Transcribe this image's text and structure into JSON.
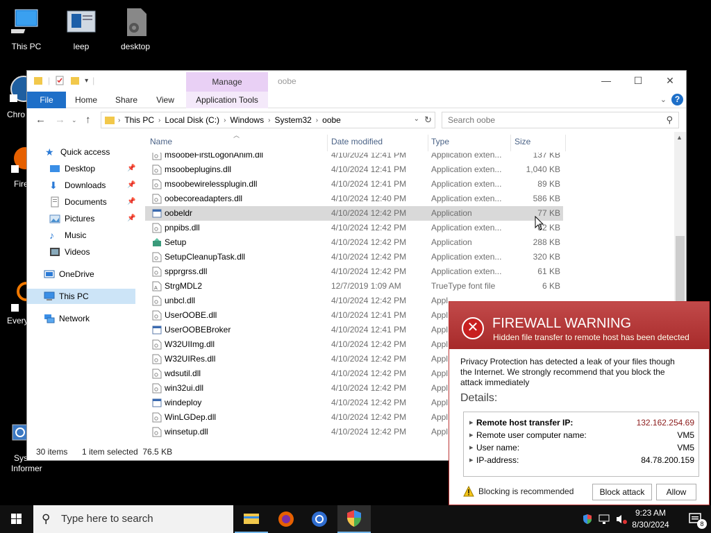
{
  "desktop": {
    "icons": [
      {
        "label": "This PC"
      },
      {
        "label": "leep"
      },
      {
        "label": "desktop"
      }
    ],
    "partial_labels": [
      "Chro",
      "Fire",
      "Every",
      "Sys",
      "Informer"
    ]
  },
  "explorer": {
    "title": "oobe",
    "manage_label": "Manage",
    "tabs": [
      "File",
      "Home",
      "Share",
      "View",
      "Application Tools"
    ],
    "breadcrumbs": [
      "This PC",
      "Local Disk (C:)",
      "Windows",
      "System32",
      "oobe"
    ],
    "search_placeholder": "Search oobe",
    "nav": {
      "quick_access": "Quick access",
      "items": [
        "Desktop",
        "Downloads",
        "Documents",
        "Pictures",
        "Music",
        "Videos"
      ],
      "onedrive": "OneDrive",
      "this_pc": "This PC",
      "network": "Network"
    },
    "columns": {
      "name": "Name",
      "date": "Date modified",
      "type": "Type",
      "size": "Size"
    },
    "files": [
      {
        "name": "msoobeFirstLogonAnim.dll",
        "date": "4/10/2024 12:41 PM",
        "type": "Application exten...",
        "size": "137 KB",
        "icon": "dll"
      },
      {
        "name": "msoobeplugins.dll",
        "date": "4/10/2024 12:41 PM",
        "type": "Application exten...",
        "size": "1,040 KB",
        "icon": "dll"
      },
      {
        "name": "msoobewirelessplugin.dll",
        "date": "4/10/2024 12:41 PM",
        "type": "Application exten...",
        "size": "89 KB",
        "icon": "dll"
      },
      {
        "name": "oobecoreadapters.dll",
        "date": "4/10/2024 12:40 PM",
        "type": "Application exten...",
        "size": "586 KB",
        "icon": "dll"
      },
      {
        "name": "oobeldr",
        "date": "4/10/2024 12:42 PM",
        "type": "Application",
        "size": "77 KB",
        "icon": "exe",
        "selected": true
      },
      {
        "name": "pnpibs.dll",
        "date": "4/10/2024 12:42 PM",
        "type": "Application exten...",
        "size": "82 KB",
        "icon": "dll"
      },
      {
        "name": "Setup",
        "date": "4/10/2024 12:42 PM",
        "type": "Application",
        "size": "288 KB",
        "icon": "setup"
      },
      {
        "name": "SetupCleanupTask.dll",
        "date": "4/10/2024 12:42 PM",
        "type": "Application exten...",
        "size": "320 KB",
        "icon": "dll"
      },
      {
        "name": "spprgrss.dll",
        "date": "4/10/2024 12:42 PM",
        "type": "Application exten...",
        "size": "61 KB",
        "icon": "dll"
      },
      {
        "name": "StrgMDL2",
        "date": "12/7/2019 1:09 AM",
        "type": "TrueType font file",
        "size": "6 KB",
        "icon": "font"
      },
      {
        "name": "unbcl.dll",
        "date": "4/10/2024 12:42 PM",
        "type": "Appl",
        "size": "",
        "icon": "dll"
      },
      {
        "name": "UserOOBE.dll",
        "date": "4/10/2024 12:41 PM",
        "type": "Appl",
        "size": "",
        "icon": "dll"
      },
      {
        "name": "UserOOBEBroker",
        "date": "4/10/2024 12:41 PM",
        "type": "Appl",
        "size": "",
        "icon": "exe"
      },
      {
        "name": "W32UIImg.dll",
        "date": "4/10/2024 12:42 PM",
        "type": "Appl",
        "size": "",
        "icon": "dll"
      },
      {
        "name": "W32UIRes.dll",
        "date": "4/10/2024 12:42 PM",
        "type": "Appl",
        "size": "",
        "icon": "dll"
      },
      {
        "name": "wdsutil.dll",
        "date": "4/10/2024 12:42 PM",
        "type": "Appl",
        "size": "",
        "icon": "dll"
      },
      {
        "name": "win32ui.dll",
        "date": "4/10/2024 12:42 PM",
        "type": "Appl",
        "size": "",
        "icon": "dll"
      },
      {
        "name": "windeploy",
        "date": "4/10/2024 12:42 PM",
        "type": "Appl",
        "size": "",
        "icon": "exe"
      },
      {
        "name": "WinLGDep.dll",
        "date": "4/10/2024 12:42 PM",
        "type": "Appl",
        "size": "",
        "icon": "dll"
      },
      {
        "name": "winsetup.dll",
        "date": "4/10/2024 12:42 PM",
        "type": "Appl",
        "size": "",
        "icon": "dll"
      }
    ],
    "status": {
      "count": "30 items",
      "selection": "1 item selected  76.5 KB"
    }
  },
  "firewall": {
    "title": "FIREWALL WARNING",
    "subtitle": "Hidden file transfer to remote host has been detected",
    "message": "Privacy Protection has detected a leak of your files though the Internet. We strongly recommend that you block the attack immediately",
    "details_label": "Details:",
    "details": [
      {
        "key": "Remote host transfer IP:",
        "value": "132.162.254.69",
        "bold": true,
        "color": "#8b1a1a"
      },
      {
        "key": "Remote user computer name:",
        "value": "VM5"
      },
      {
        "key": "User name:",
        "value": "VM5"
      },
      {
        "key": "IP-address:",
        "value": "84.78.200.159"
      }
    ],
    "recommendation": "Blocking is recommended",
    "block_label": "Block attack",
    "allow_label": "Allow"
  },
  "taskbar": {
    "search_placeholder": "Type here to search",
    "time": "9:23 AM",
    "date": "8/30/2024",
    "notification_count": "8"
  },
  "colors": {
    "accent": "#1e6fc8",
    "selection": "#cce4f7",
    "firewall_red": "#b03030",
    "manage_band": "#e9d0f5"
  }
}
